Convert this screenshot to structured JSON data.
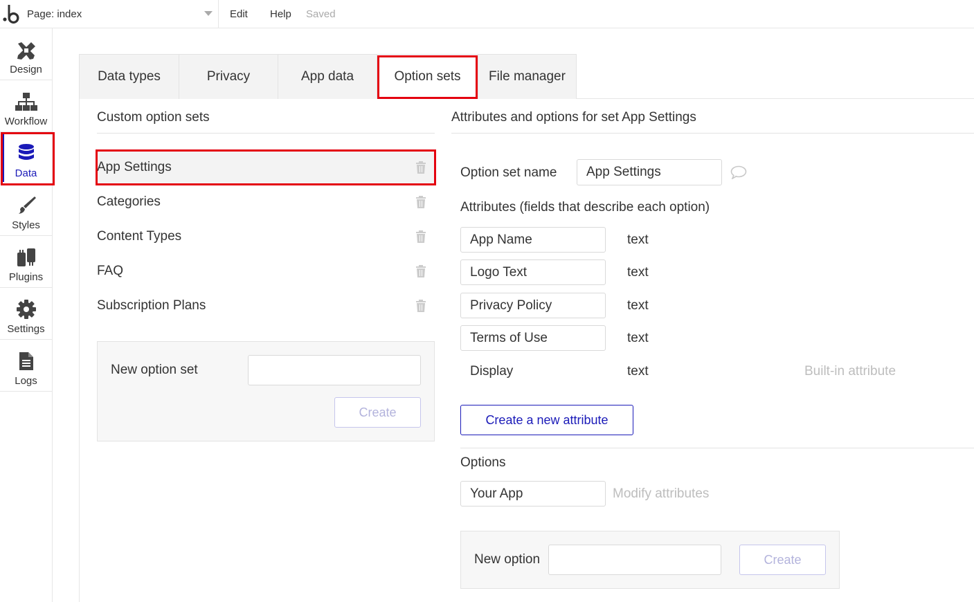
{
  "app": {
    "page_selector": "Page: index",
    "menu": {
      "edit": "Edit",
      "help": "Help"
    },
    "status": "Saved"
  },
  "sidebar": {
    "items": [
      {
        "label": "Design",
        "icon": "design-icon"
      },
      {
        "label": "Workflow",
        "icon": "workflow-icon"
      },
      {
        "label": "Data",
        "icon": "database-icon",
        "active": true
      },
      {
        "label": "Styles",
        "icon": "brush-icon"
      },
      {
        "label": "Plugins",
        "icon": "plug-icon"
      },
      {
        "label": "Settings",
        "icon": "gear-icon"
      },
      {
        "label": "Logs",
        "icon": "document-icon"
      }
    ]
  },
  "tabs": [
    {
      "label": "Data types"
    },
    {
      "label": "Privacy"
    },
    {
      "label": "App data"
    },
    {
      "label": "Option sets",
      "active": true
    },
    {
      "label": "File manager"
    }
  ],
  "left_panel": {
    "title": "Custom option sets",
    "option_sets": [
      {
        "name": "App Settings",
        "selected": true
      },
      {
        "name": "Categories"
      },
      {
        "name": "Content Types"
      },
      {
        "name": "FAQ"
      },
      {
        "name": "Subscription Plans"
      }
    ],
    "new_option_set": {
      "label": "New option set",
      "value": "",
      "button": "Create"
    }
  },
  "right_panel": {
    "title": "Attributes and options for set App Settings",
    "option_set_name_label": "Option set name",
    "option_set_name_value": "App Settings",
    "attributes_title": "Attributes (fields that describe each option)",
    "attributes": [
      {
        "name": "App Name",
        "type": "text"
      },
      {
        "name": "Logo Text",
        "type": "text"
      },
      {
        "name": "Privacy Policy",
        "type": "text"
      },
      {
        "name": "Terms of Use",
        "type": "text"
      },
      {
        "name": "Display",
        "type": "text",
        "note": "Built-in attribute"
      }
    ],
    "create_attribute_button": "Create a new attribute",
    "options_title": "Options",
    "options": [
      {
        "name": "Your App",
        "action": "Modify attributes"
      }
    ],
    "new_option": {
      "label": "New option",
      "value": "",
      "button": "Create"
    }
  },
  "colors": {
    "accent": "#1a1ab8",
    "highlight": "#e4000f"
  }
}
